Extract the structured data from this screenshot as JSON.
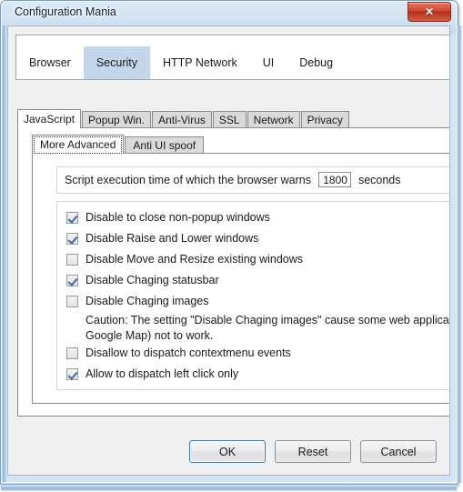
{
  "window": {
    "title": "Configuration Mania",
    "close_label": "✕",
    "close_icon": "close-icon"
  },
  "tabs_level1": {
    "items": [
      {
        "label": "Browser",
        "selected": false
      },
      {
        "label": "Security",
        "selected": true
      },
      {
        "label": "HTTP Network",
        "selected": false
      },
      {
        "label": "UI",
        "selected": false
      },
      {
        "label": "Debug",
        "selected": false
      }
    ],
    "selected_color": "#c3d6ea"
  },
  "tabs_level2": {
    "items": [
      {
        "label": "JavaScript",
        "selected": true
      },
      {
        "label": "Popup Win.",
        "selected": false
      },
      {
        "label": "Anti-Virus",
        "selected": false
      },
      {
        "label": "SSL",
        "selected": false
      },
      {
        "label": "Network",
        "selected": false
      },
      {
        "label": "Privacy",
        "selected": false
      }
    ]
  },
  "tabs_level3": {
    "items": [
      {
        "label": "More Advanced",
        "selected": true,
        "focused": true
      },
      {
        "label": "Anti UI spoof",
        "selected": false,
        "focused": false
      }
    ]
  },
  "script_time": {
    "label_before": "Script execution time of which the browser warns",
    "value": "1800",
    "placeholder": "",
    "unit": "seconds"
  },
  "options": {
    "checkboxes": [
      {
        "label": "Disable to close non-popup windows",
        "checked": true
      },
      {
        "label": "Disable Raise and Lower windows",
        "checked": true
      },
      {
        "label": "Disable Move and Resize existing windows",
        "checked": false
      },
      {
        "label": "Disable Chaging statusbar",
        "checked": true
      },
      {
        "label": "Disable Chaging images",
        "checked": false
      },
      {
        "label": "Disallow to dispatch contextmenu events",
        "checked": false
      },
      {
        "label": "Allow to dispatch left click only",
        "checked": true
      }
    ],
    "caution_line1": "Caution: The setting \"Disable Chaging images\" cause some web applications (such as",
    "caution_line2": "Google Map) not to work."
  },
  "buttons": {
    "ok": "OK",
    "reset": "Reset",
    "cancel": "Cancel"
  }
}
